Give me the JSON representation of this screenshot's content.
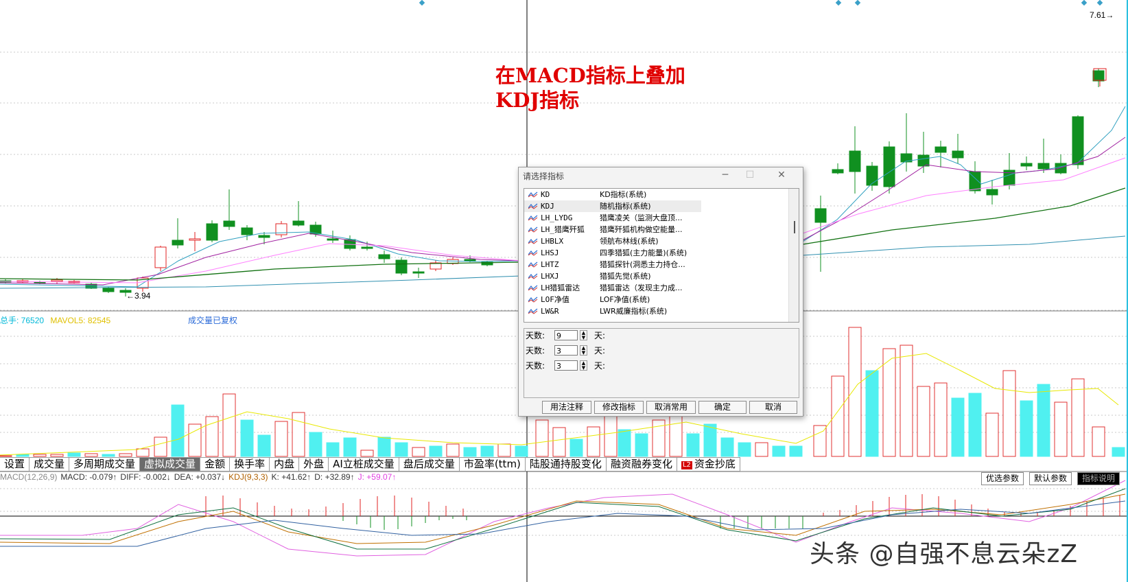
{
  "price_panel": {
    "price_right_label": "7.61",
    "low_label": "3.94"
  },
  "annotation": {
    "text": "在MACD指标上叠加\nKDJ指标"
  },
  "volume_legend": {
    "items": [
      {
        "text": "总手: 76520",
        "color": "#00b8d8"
      },
      {
        "text": "MAVOL5: 82545",
        "color": "#e0c000"
      }
    ],
    "note": "成交量已复权",
    "note_color": "#2a6ad8"
  },
  "bottom_tabs": [
    {
      "label": "设置",
      "active": false
    },
    {
      "label": "成交量",
      "active": false
    },
    {
      "label": "多周期成交量",
      "active": false
    },
    {
      "label": "虚拟成交量",
      "active": true
    },
    {
      "label": "金额",
      "active": false
    },
    {
      "label": "换手率",
      "active": false
    },
    {
      "label": "内盘",
      "active": false
    },
    {
      "label": "外盘",
      "active": false
    },
    {
      "label": "AI立桩成交量",
      "active": false
    },
    {
      "label": "盘后成交量",
      "active": false
    },
    {
      "label": "市盈率(ttm)",
      "active": false
    },
    {
      "label": "陆股通持股变化",
      "active": false
    },
    {
      "label": "融资融券变化",
      "active": false
    },
    {
      "label": "资金抄底",
      "active": false,
      "badge": "L2"
    }
  ],
  "macd_legend": {
    "items": [
      {
        "text": "MACD(12,26,9)",
        "color": "#888888"
      },
      {
        "text": "MACD: -0.079↑",
        "color": "#333333"
      },
      {
        "text": "DIFF: -0.002↓",
        "color": "#333333"
      },
      {
        "text": "DEA: +0.037↓",
        "color": "#333333"
      },
      {
        "text": "KDJ(9,3,3)",
        "color": "#b06000"
      },
      {
        "text": "K: +41.62↑",
        "color": "#333333"
      },
      {
        "text": "D: +32.89↑",
        "color": "#333333"
      },
      {
        "text": "J: +59.07↑",
        "color": "#e040e0"
      }
    ]
  },
  "param_buttons": [
    "优选参数",
    "默认参数",
    "指标说明"
  ],
  "watermark": "头条 @自强不息云朵zZ",
  "dialog": {
    "title": "请选择指标",
    "indicators": [
      {
        "name": "KD",
        "desc": "KD指标(系统)"
      },
      {
        "name": "KDJ",
        "desc": "随机指标(系统)",
        "selected": true
      },
      {
        "name": "LH_LYDG",
        "desc": "猎鹰凌关（监测大盘顶..."
      },
      {
        "name": "LH_猎鹰歼狐",
        "desc": "猎鹰歼狐机构做空能量..."
      },
      {
        "name": "LHBLX",
        "desc": "领航布林线(系统)"
      },
      {
        "name": "LHSJ",
        "desc": "四季猎狐(主力能量)(系统)"
      },
      {
        "name": "LHTZ",
        "desc": "猎狐探针(洞悉主力持仓..."
      },
      {
        "name": "LHXJ",
        "desc": "猎狐先觉(系统)"
      },
      {
        "name": "LH猎狐雷达",
        "desc": "猎狐雷达（发现主力成..."
      },
      {
        "name": "LOF净值",
        "desc": "LOF净值(系统)"
      },
      {
        "name": "LW&R",
        "desc": "LWR威廉指标(系统)"
      }
    ],
    "params": [
      {
        "label": "天数:",
        "value": "9",
        "unit": "天:"
      },
      {
        "label": "天数:",
        "value": "3",
        "unit": "天:"
      },
      {
        "label": "天数:",
        "value": "3",
        "unit": "天:"
      }
    ],
    "buttons": [
      "用法注释",
      "修改指标",
      "取消常用",
      "确定",
      "取消"
    ]
  },
  "colors": {
    "up": "#e02020",
    "down": "#109020",
    "vol_up": "#e03030",
    "vol_down": "#50f0f0",
    "ma5": "#30a0c0",
    "ma10": "#a020a0",
    "ma20": "#ff80ff",
    "ma30": "#107010",
    "ma60": "#3090b0"
  }
}
